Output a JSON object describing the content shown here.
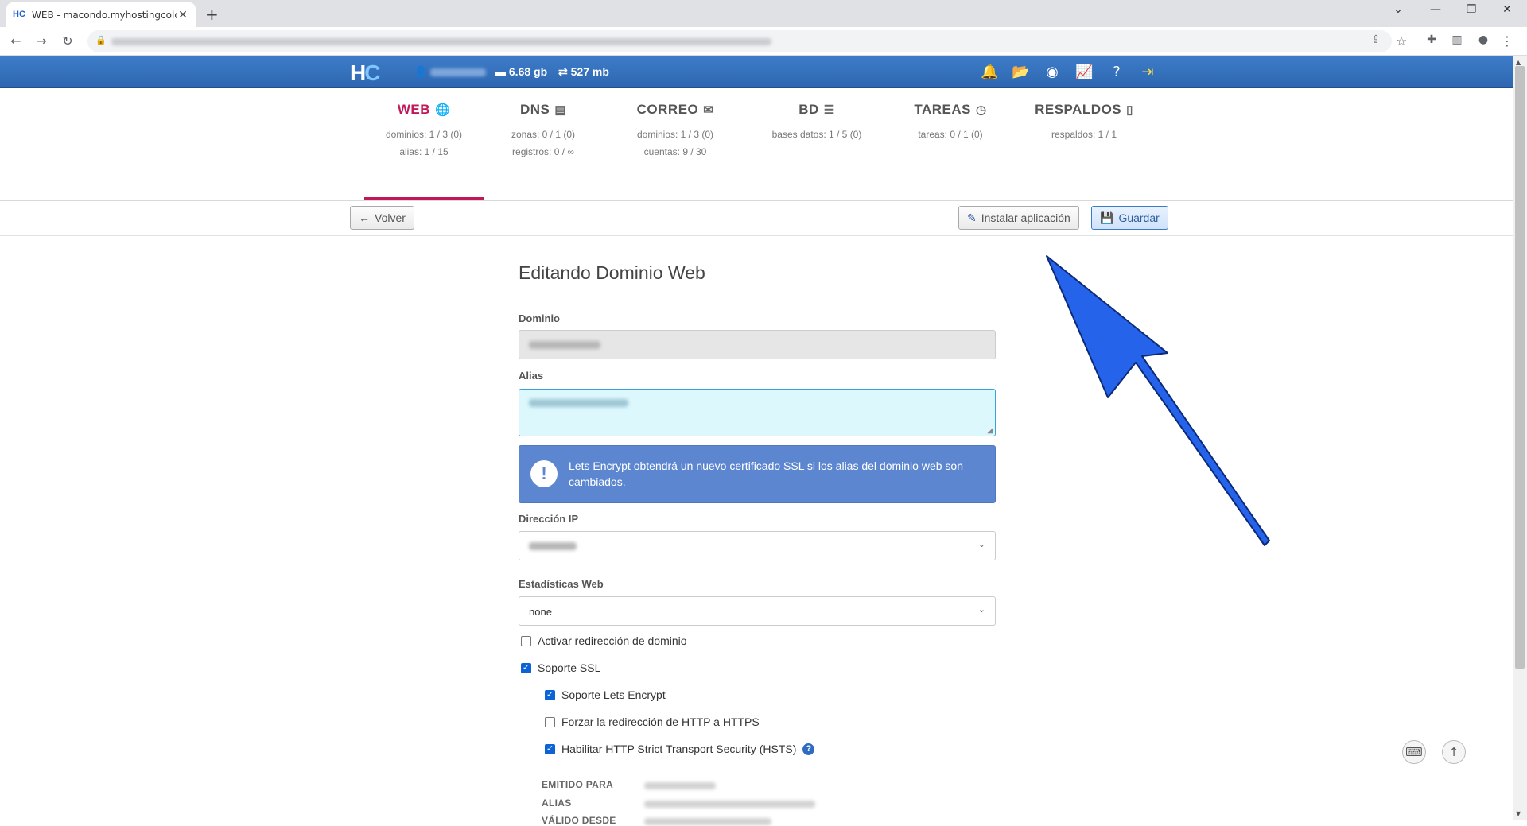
{
  "browser": {
    "tab_title": "WEB - macondo.myhostingcolom",
    "tab_favicon": "HC"
  },
  "header": {
    "disk": "6.68 gb",
    "transfer": "527 mb"
  },
  "sections": [
    {
      "title": "WEB",
      "icon": "globe-icon",
      "lines": [
        "dominios: 1 / 3 (0)",
        "alias: 1 / 15"
      ],
      "active": true
    },
    {
      "title": "DNS",
      "icon": "book-icon",
      "lines": [
        "zonas: 0 / 1 (0)",
        "registros: 0 / ∞"
      ]
    },
    {
      "title": "CORREO",
      "icon": "mail-icon",
      "lines": [
        "dominios: 1 / 3 (0)",
        "cuentas: 9 / 30"
      ]
    },
    {
      "title": "BD",
      "icon": "database-icon",
      "lines": [
        "bases datos: 1 / 5 (0)"
      ]
    },
    {
      "title": "TAREAS",
      "icon": "clock-icon",
      "lines": [
        "tareas: 0 / 1 (0)"
      ]
    },
    {
      "title": "RESPALDOS",
      "icon": "file-icon",
      "lines": [
        "respaldos: 1 / 1"
      ]
    }
  ],
  "actions": {
    "back": "Volver",
    "install": "Instalar aplicación",
    "save": "Guardar"
  },
  "form": {
    "title": "Editando Dominio Web",
    "domain_label": "Dominio",
    "alias_label": "Alias",
    "alert": "Lets Encrypt obtendrá un nuevo certificado SSL si los alias del dominio web son cambiados.",
    "ip_label": "Dirección IP",
    "stats_label": "Estadísticas Web",
    "stats_value": "none",
    "redirect_label": "Activar redirección de dominio",
    "ssl_label": "Soporte SSL",
    "letsencrypt_label": "Soporte Lets Encrypt",
    "force_https_label": "Forzar la redirección de HTTP a HTTPS",
    "hsts_label": "Habilitar HTTP Strict Transport Security (HSTS)",
    "cert_issued_for": "EMITIDO PARA",
    "cert_alias": "ALIAS",
    "cert_valid_from": "VÁLIDO DESDE"
  },
  "colors": {
    "accent": "#c0185a",
    "header": "#2e67b0",
    "arrow": "#2563eb"
  }
}
